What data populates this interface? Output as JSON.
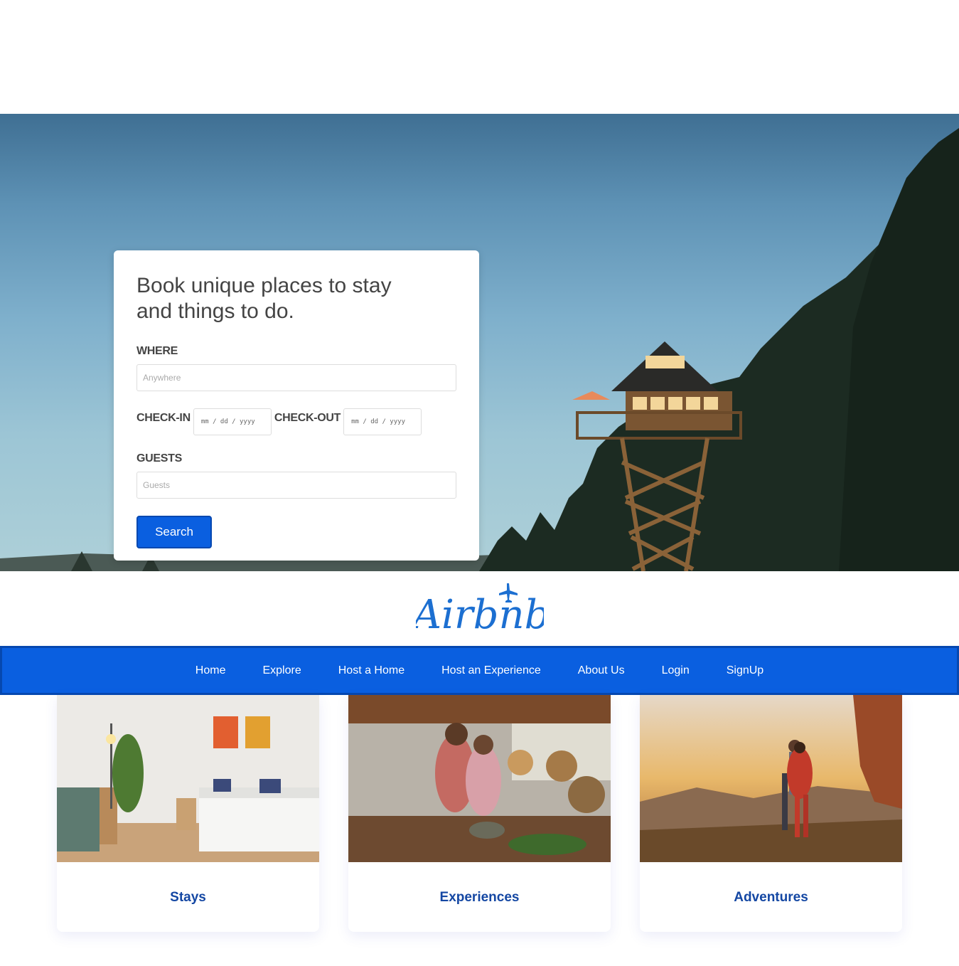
{
  "hero": {
    "title": "Book unique places to stay and things to do.",
    "where_label": "WHERE",
    "where_placeholder": "Anywhere",
    "checkin_label": "CHECK-IN",
    "checkout_label": "CHECK-OUT",
    "date_placeholder": "mm / dd / yyyy",
    "guests_label": "GUESTS",
    "guests_placeholder": "Guests",
    "search_label": "Search"
  },
  "logo": {
    "text": "Airbnb"
  },
  "nav": {
    "items": [
      "Home",
      "Explore",
      "Host a Home",
      "Host an Experience",
      "About Us",
      "Login",
      "SignUp"
    ]
  },
  "cards": [
    {
      "title": "Stays",
      "image": "bedroom-photo"
    },
    {
      "title": "Experiences",
      "image": "cooking-photo"
    },
    {
      "title": "Adventures",
      "image": "hiking-sunset-photo"
    }
  ],
  "colors": {
    "primary": "#0a5fe0",
    "card_title": "#1447a3",
    "text": "#444444"
  }
}
